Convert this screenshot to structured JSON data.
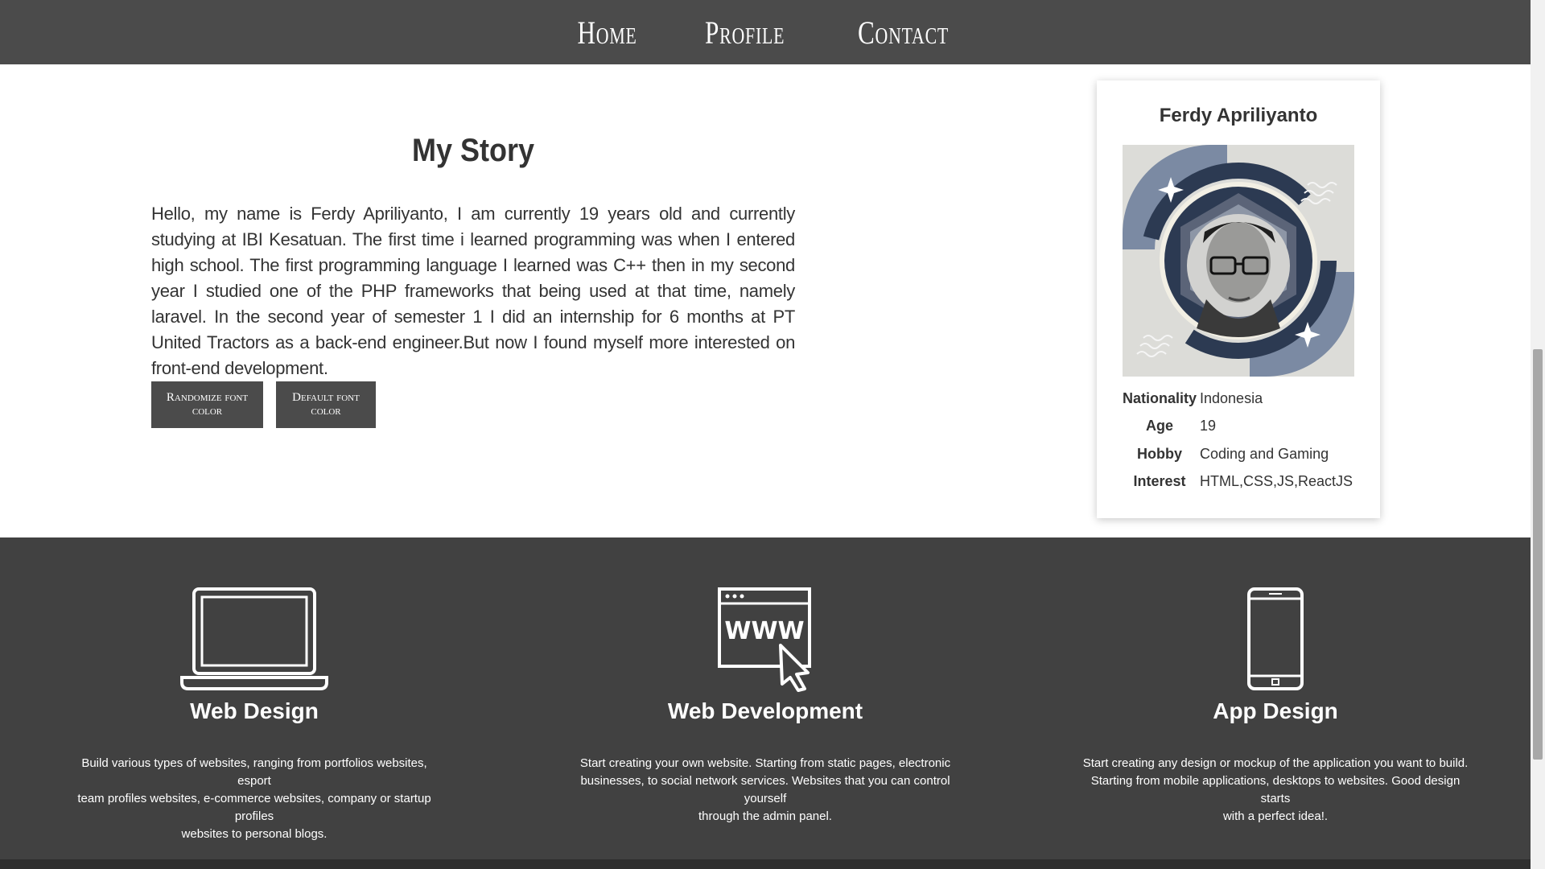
{
  "nav": {
    "items": [
      {
        "label": "Home"
      },
      {
        "label": "Profile"
      },
      {
        "label": "Contact"
      }
    ]
  },
  "story": {
    "title": "My Story",
    "text": "Hello, my name is Ferdy Apriliyanto, I am currently 19 years old and currently studying at IBI Kesatuan. The first time i learned programming was when I entered high school. The first programming language I learned was C++ then in my second year I studied one of the PHP frameworks that being used at that time, namely laravel. In the second year of semester 1 I did an internship for 6 months at PT United Tractors as a back-end engineer.But now I found myself more interested on front-end development.",
    "buttons": {
      "randomize": "Randomize font color",
      "default": "Default font color"
    }
  },
  "profile": {
    "name": "Ferdy Apriliyanto",
    "rows": [
      {
        "key": "Nationality",
        "value": "Indonesia"
      },
      {
        "key": "Age",
        "value": "19"
      },
      {
        "key": "Hobby",
        "value": "Coding and Gaming"
      },
      {
        "key": "Interest",
        "value": "HTML,CSS,JS,ReactJS"
      }
    ]
  },
  "services": [
    {
      "icon": "laptop-icon",
      "title": "Web Design",
      "desc_lines": [
        "Build various types of websites, ranging from portfolios websites, esport",
        "team profiles websites, e-commerce websites, company or startup profiles",
        "websites to personal blogs."
      ]
    },
    {
      "icon": "www-browser-icon",
      "title": "Web Development",
      "icon_text": "WWW",
      "desc_lines": [
        "Start creating your own website. Starting from static pages, electronic",
        "businesses, to social network services. Websites that you can control yourself",
        "through the admin panel."
      ]
    },
    {
      "icon": "smartphone-icon",
      "title": "App Design",
      "desc_lines": [
        "Start creating any design or mockup of the application you want to build.",
        "Starting from mobile applications, desktops to websites. Good design starts",
        "with a perfect idea!."
      ]
    }
  ],
  "colors": {
    "nav_bg": "#4b4b4b",
    "services_bg": "#414141",
    "text": "#333333"
  }
}
